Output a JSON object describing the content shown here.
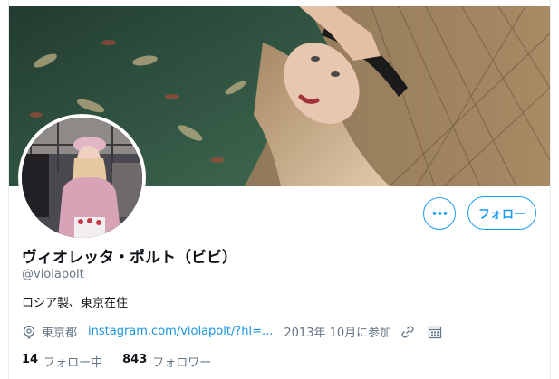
{
  "profile": {
    "display_name": "ヴィオレッタ・ポルト（ビビ）",
    "handle": "@violapolt",
    "bio": "ロシア製、東京在住",
    "location": "東京都",
    "website": "instagram.com/violapolt/?hl=...",
    "joined": "2013年 10月に参加"
  },
  "actions": {
    "more_label": "•••",
    "follow_label": "フォロー"
  },
  "stats": {
    "following_count": "14",
    "following_label": "フォロー中",
    "followers_count": "843",
    "followers_label": "フォロワー"
  },
  "icons": {
    "location": "location-pin-icon",
    "link": "link-icon",
    "calendar": "calendar-icon",
    "more": "more-icon"
  },
  "colors": {
    "accent": "#1d9bf0",
    "link": "#1b95e0",
    "muted": "#657786",
    "text": "#0f1419"
  }
}
